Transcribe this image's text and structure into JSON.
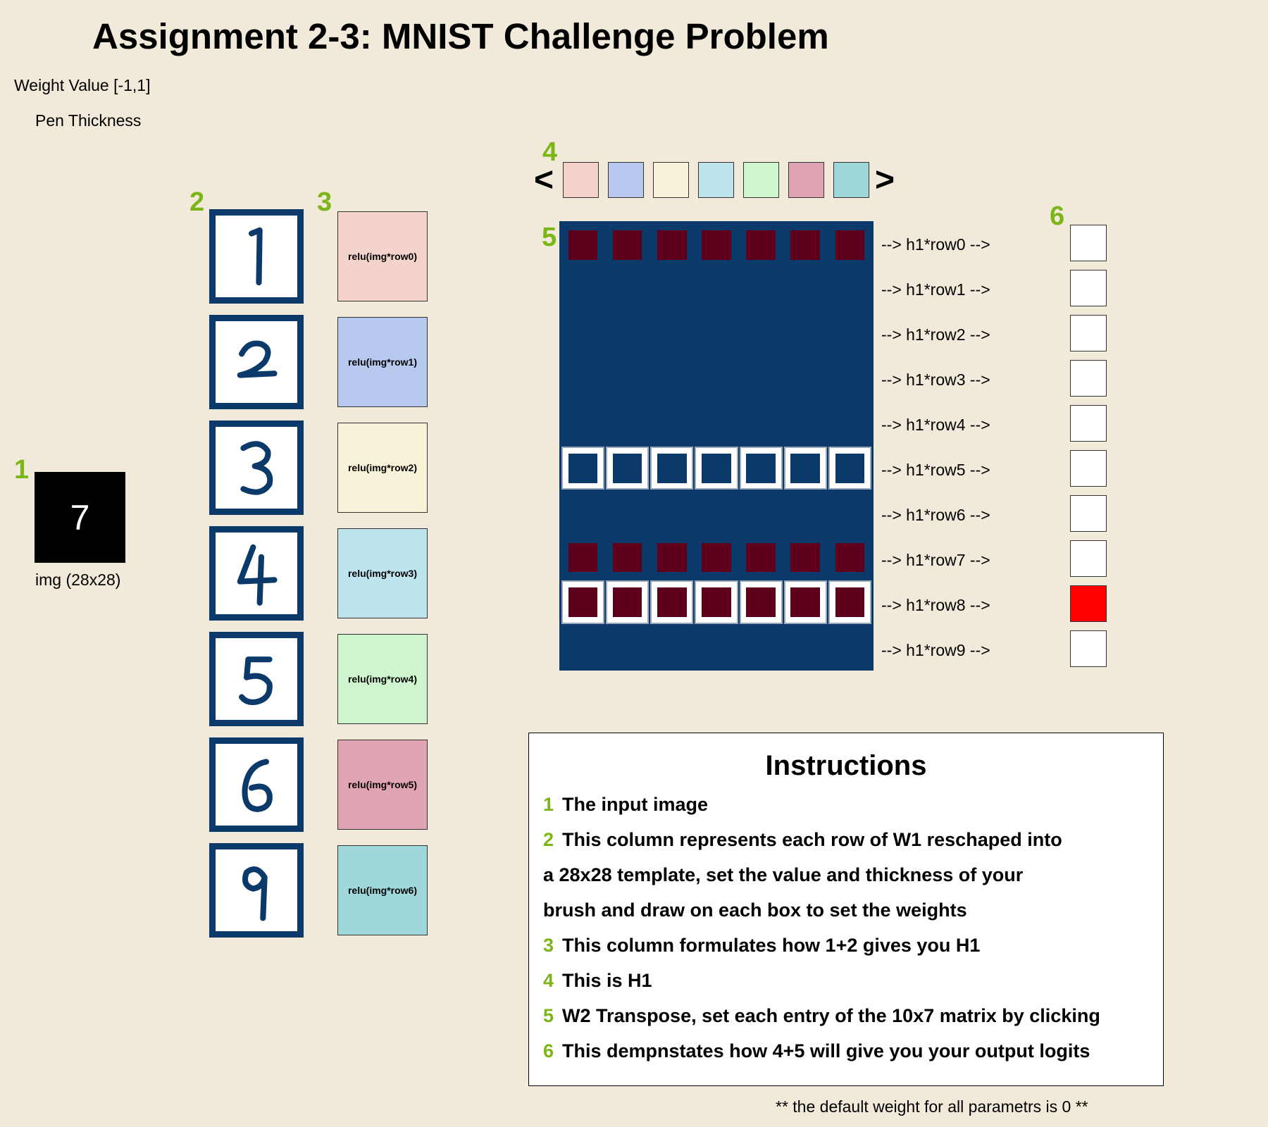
{
  "title": "Assignment 2-3: MNIST Challenge Problem",
  "controls": {
    "weight_label": "Weight Value [-1,1]",
    "pen_label": "Pen Thickness"
  },
  "markers": [
    "1",
    "2",
    "3",
    "4",
    "5",
    "6"
  ],
  "input": {
    "digit": "7",
    "caption": "img (28x28)"
  },
  "templates": [
    {
      "digit": "1"
    },
    {
      "digit": "2"
    },
    {
      "digit": "3"
    },
    {
      "digit": "4"
    },
    {
      "digit": "5"
    },
    {
      "digit": "6"
    },
    {
      "digit": "9"
    }
  ],
  "relu_boxes": [
    {
      "label": "relu(img*row0)",
      "color": "#f3d3cc"
    },
    {
      "label": "relu(img*row1)",
      "color": "#b8c9ef"
    },
    {
      "label": "relu(img*row2)",
      "color": "#f8f3d8"
    },
    {
      "label": "relu(img*row3)",
      "color": "#bee4ef"
    },
    {
      "label": "relu(img*row4)",
      "color": "#cff5cf"
    },
    {
      "label": "relu(img*row5)",
      "color": "#e1a4b3"
    },
    {
      "label": "relu(img*row6)",
      "color": "#9fd8db"
    }
  ],
  "h1": {
    "prev_label": "<",
    "next_label": ">",
    "colors": [
      "#f3d3cc",
      "#b8c9ef",
      "#f8f3d8",
      "#bee4ef",
      "#cff5cf",
      "#e1a4b3",
      "#9fd8db"
    ]
  },
  "w2": {
    "rows": [
      {
        "label": "--> h1*row0 -->",
        "style": "solid",
        "inner": "pos"
      },
      {
        "label": "--> h1*row1 -->",
        "style": "solid",
        "inner": "none"
      },
      {
        "label": "--> h1*row2 -->",
        "style": "solid",
        "inner": "none"
      },
      {
        "label": "--> h1*row3 -->",
        "style": "solid",
        "inner": "none"
      },
      {
        "label": "--> h1*row4 -->",
        "style": "solid",
        "inner": "none"
      },
      {
        "label": "--> h1*row5 -->",
        "style": "outlined",
        "inner": "neutral"
      },
      {
        "label": "--> h1*row6 -->",
        "style": "solid",
        "inner": "none"
      },
      {
        "label": "--> h1*row7 -->",
        "style": "solid",
        "inner": "pos"
      },
      {
        "label": "--> h1*row8 -->",
        "style": "outlined",
        "inner": "pos"
      },
      {
        "label": "--> h1*row9 -->",
        "style": "solid",
        "inner": "none"
      }
    ],
    "columns": 7,
    "colors": {
      "dark": "#0b3a6a",
      "positive": "#5e001c"
    }
  },
  "logits": {
    "highlight_color": "#ff0000",
    "default_color": "#ffffff",
    "active_index": 8
  },
  "instructions": {
    "title": "Instructions",
    "lines": [
      {
        "num": "1",
        "text": "The input image"
      },
      {
        "num": "2",
        "text": "This column represents each row of W1 reschaped into"
      },
      {
        "num": "",
        "text": "a 28x28 template, set the value and thickness of your"
      },
      {
        "num": "",
        "text": "brush and draw on each box to set the weights"
      },
      {
        "num": "3",
        "text": "This column formulates how 1+2 gives you H1"
      },
      {
        "num": "4",
        "text": "This is H1"
      },
      {
        "num": "5",
        "text": "W2 Transpose, set each entry of the 10x7 matrix by clicking"
      },
      {
        "num": "6",
        "text": "This dempnstates how 4+5 will give you your output logits"
      }
    ]
  },
  "footnote": "** the default weight for all parametrs is 0 **"
}
